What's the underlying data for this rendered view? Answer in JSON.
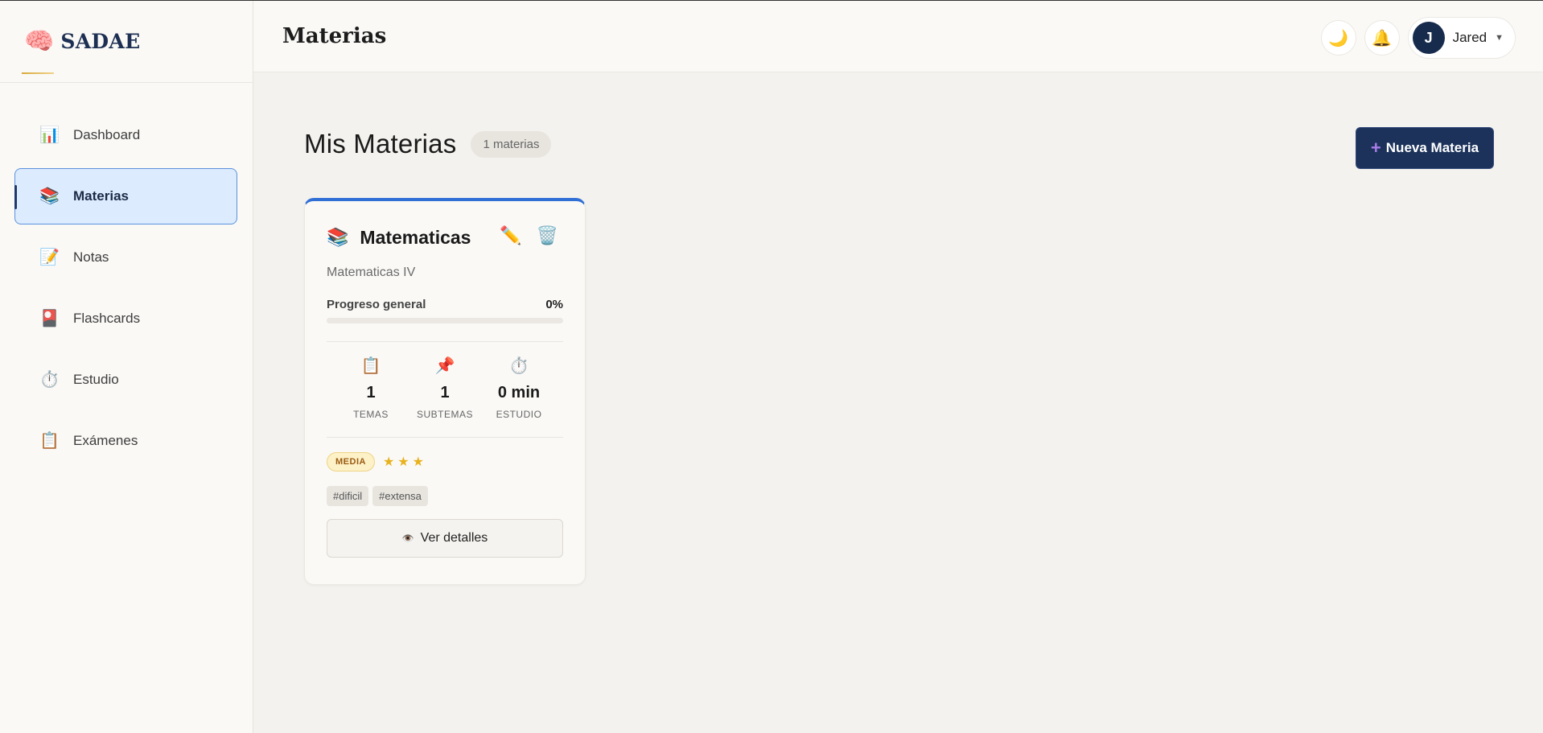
{
  "brand": {
    "name": "SADAE",
    "icon": "brain-icon"
  },
  "sidebar": {
    "items": [
      {
        "label": "Dashboard",
        "icon": "📊",
        "icon_name": "bar-chart-icon",
        "active": false
      },
      {
        "label": "Materias",
        "icon": "📚",
        "icon_name": "books-icon",
        "active": true
      },
      {
        "label": "Notas",
        "icon": "📝",
        "icon_name": "memo-icon",
        "active": false
      },
      {
        "label": "Flashcards",
        "icon": "🎴",
        "icon_name": "flashcard-icon",
        "active": false
      },
      {
        "label": "Estudio",
        "icon": "⏱️",
        "icon_name": "stopwatch-icon",
        "active": false
      },
      {
        "label": "Exámenes",
        "icon": "📋",
        "icon_name": "clipboard-icon",
        "active": false
      }
    ]
  },
  "header": {
    "title": "Materias",
    "theme_icon": "🌙",
    "bell_icon": "🔔",
    "user": {
      "initial": "J",
      "name": "Jared"
    }
  },
  "main": {
    "title": "Mis Materias",
    "count_badge": "1 materias",
    "new_button": {
      "plus": "+",
      "label": "Nueva Materia"
    }
  },
  "card": {
    "icon": "📚",
    "title": "Matematicas",
    "edit_icon": "✏️",
    "delete_icon": "🗑️",
    "subtitle": "Matematicas IV",
    "progress_label": "Progreso general",
    "progress_value": "0%",
    "progress_fraction": 0,
    "stats": [
      {
        "icon": "📋",
        "icon_name": "clipboard-icon",
        "value": "1",
        "label": "TEMAS"
      },
      {
        "icon": "📌",
        "icon_name": "pushpin-icon",
        "value": "1",
        "label": "SUBTEMAS"
      },
      {
        "icon": "⏱️",
        "icon_name": "stopwatch-icon",
        "value": "0 min",
        "label": "ESTUDIO"
      }
    ],
    "level": "MEDIA",
    "stars": "★★★",
    "star_count": 3,
    "tags": [
      "#dificil",
      "#extensa"
    ],
    "detail_button": {
      "icon": "👁️",
      "label": "Ver detalles"
    }
  },
  "colors": {
    "accent": "#2f6fd6",
    "primary_dark": "#1c325b",
    "active_nav_bg": "#dcebfe",
    "star": "#e8b21e"
  }
}
